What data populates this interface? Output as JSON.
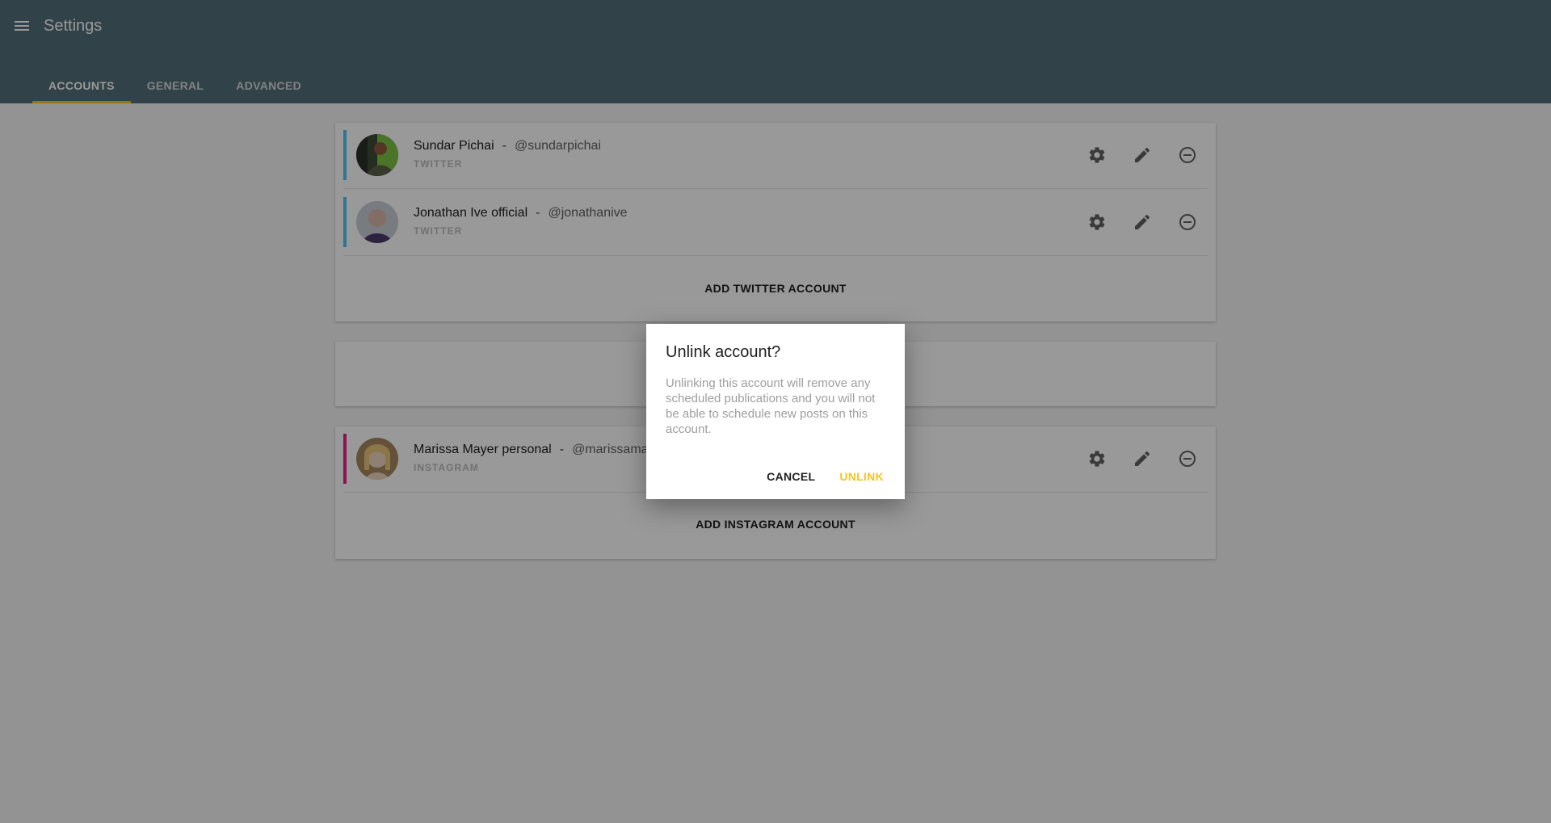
{
  "header": {
    "title": "Settings",
    "tabs": [
      {
        "label": "ACCOUNTS",
        "active": true
      },
      {
        "label": "GENERAL",
        "active": false
      },
      {
        "label": "ADVANCED",
        "active": false
      }
    ]
  },
  "twitter": {
    "accounts": [
      {
        "name": "Sundar Pichai",
        "separator": "-",
        "handle": "@sundarpichai",
        "network": "TWITTER"
      },
      {
        "name": "Jonathan Ive official",
        "separator": "-",
        "handle": "@jonathanive",
        "network": "TWITTER"
      }
    ],
    "add_label": "ADD TWITTER ACCOUNT"
  },
  "instagram": {
    "accounts": [
      {
        "name": "Marissa Mayer personal",
        "separator": "-",
        "handle": "@marissama",
        "network": "INSTAGRAM"
      }
    ],
    "add_label": "ADD INSTAGRAM ACCOUNT"
  },
  "dialog": {
    "title": "Unlink account?",
    "body": "Unlinking this account will remove any scheduled publications and you will not be able to schedule new posts on this account.",
    "cancel_label": "CANCEL",
    "confirm_label": "UNLINK"
  },
  "colors": {
    "appbar": "#546e7a",
    "accent": "#f3c622",
    "twitter_bar": "#4fc3f7",
    "instagram_bar": "#e91e8c",
    "icon": "#616161"
  },
  "icons": [
    "menu-icon",
    "gear-icon",
    "pencil-icon",
    "remove-circle-icon"
  ]
}
